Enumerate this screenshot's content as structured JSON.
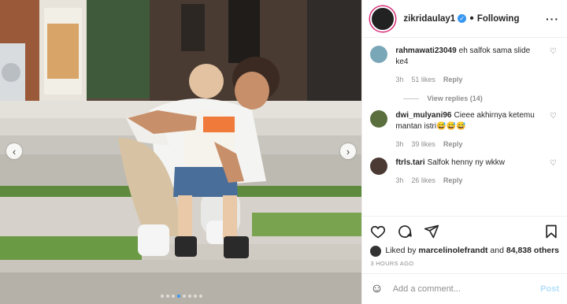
{
  "header": {
    "username": "zikridaulay1",
    "separator": "•",
    "follow_status": "Following",
    "more": "···"
  },
  "comments": [
    {
      "user": "rahmawati23049",
      "text": "eh salfok sama slide ke4",
      "time": "3h",
      "likes": "51 likes",
      "reply": "Reply"
    },
    {
      "user": "dwi_mulyani96",
      "text": "Cieee akhirnya ketemu mantan istri😅😅😅",
      "time": "3h",
      "likes": "39 likes",
      "reply": "Reply"
    },
    {
      "user": "ftrls.tari",
      "text": "Salfok henny ny wkkw",
      "time": "3h",
      "likes": "26 likes",
      "reply": "Reply"
    }
  ],
  "view_replies": "View replies (14)",
  "likes": {
    "prefix": "Liked by",
    "user": "marcelinolefrandt",
    "and": "and",
    "others": "84,838 others"
  },
  "time_ago": "3 HOURS AGO",
  "add_comment": {
    "placeholder": "Add a comment...",
    "post": "Post"
  },
  "carousel": {
    "slides": 8,
    "active_index": 3
  },
  "icons": [
    "heart-icon",
    "comment-icon",
    "share-icon",
    "bookmark-icon",
    "emoji-icon",
    "verified-icon",
    "chevron-left-icon",
    "chevron-right-icon"
  ],
  "colors": {
    "accent": "#3897f0",
    "post_disabled": "#b2dffc",
    "muted": "#8e8e8e"
  }
}
